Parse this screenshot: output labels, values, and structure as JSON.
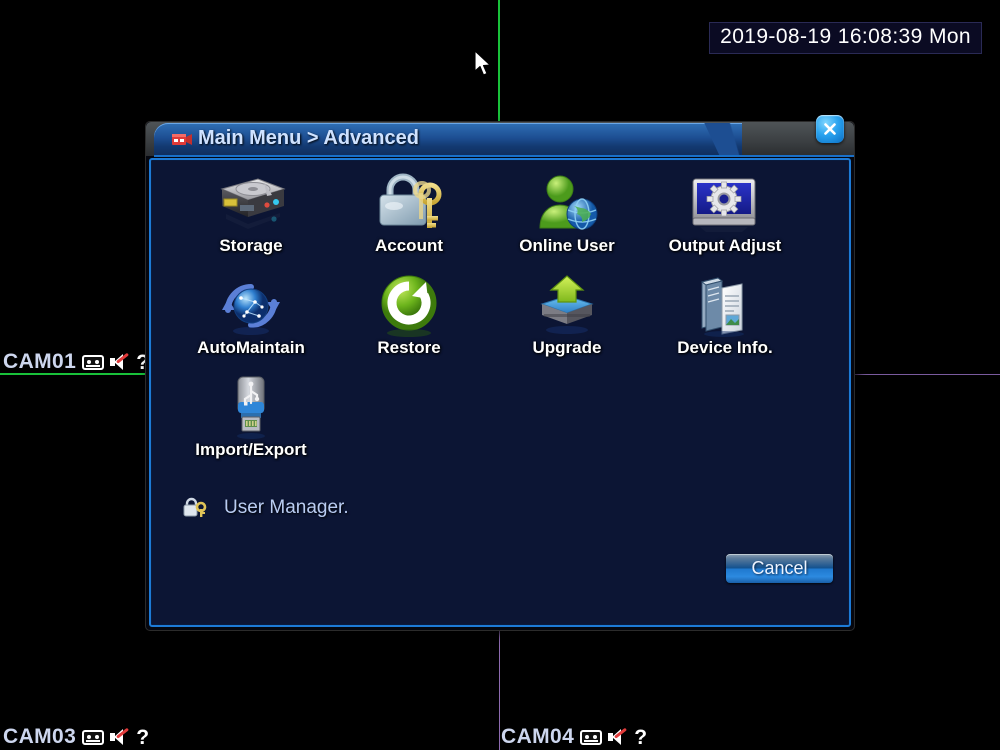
{
  "osd": {
    "timestamp": "2019-08-19 16:08:39 Mon"
  },
  "liveview": {
    "channels": [
      {
        "name": "CAM01",
        "rec_icon": "record-icon",
        "audio_icon": "speaker-muted-icon",
        "status_icon": "question-mark-icon"
      },
      {
        "name": "CAM03",
        "rec_icon": "record-icon",
        "audio_icon": "speaker-muted-icon",
        "status_icon": "question-mark-icon"
      },
      {
        "name": "CAM04",
        "rec_icon": "record-icon",
        "audio_icon": "speaker-muted-icon",
        "status_icon": "question-mark-icon"
      }
    ],
    "selected_border_color": "#19c13a",
    "divider_color": "#8d6ab0"
  },
  "dialog": {
    "title": "Main Menu > Advanced",
    "title_icon": "menu-camera-icon",
    "close_icon": "close-icon",
    "accent_color": "#1d7ad6",
    "body_color": "#0c1534",
    "menu_items": [
      {
        "label": "Storage",
        "icon": "hard-drive-icon"
      },
      {
        "label": "Account",
        "icon": "padlock-key-icon"
      },
      {
        "label": "Online User",
        "icon": "user-globe-icon"
      },
      {
        "label": "Output Adjust",
        "icon": "monitor-gear-icon"
      },
      {
        "label": "AutoMaintain",
        "icon": "globe-refresh-icon"
      },
      {
        "label": "Restore",
        "icon": "green-refresh-icon"
      },
      {
        "label": "Upgrade",
        "icon": "upload-arrow-icon"
      },
      {
        "label": "Device Info.",
        "icon": "book-document-icon"
      },
      {
        "label": "Import/Export",
        "icon": "usb-drive-icon"
      }
    ],
    "user_manager": {
      "label": "User Manager.",
      "icon": "padlock-key-small-icon"
    },
    "cancel_label": "Cancel"
  }
}
